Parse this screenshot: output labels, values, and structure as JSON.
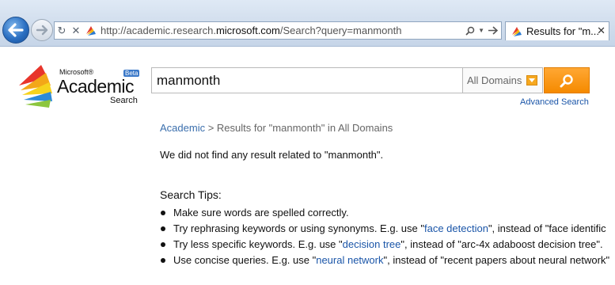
{
  "browser": {
    "url_prefix": "http://academic.research.",
    "url_domain": "microsoft.com",
    "url_suffix": "/Search?query=manmonth",
    "tab_title": "Results for \"m...",
    "icons": [
      "back-arrow-icon",
      "forward-arrow-icon",
      "refresh-icon",
      "stop-icon",
      "favicon",
      "search-icon",
      "dropdown-icon",
      "go-arrow-icon",
      "close-icon"
    ]
  },
  "logo": {
    "microsoft": "Microsoft®",
    "academic": "Academic",
    "search": "Search",
    "beta": "Beta"
  },
  "search": {
    "query": "manmonth",
    "domain": "All Domains",
    "advanced": "Advanced Search"
  },
  "breadcrumb": {
    "root": "Academic",
    "separator": ">",
    "current": "Results for \"manmonth\" in All Domains"
  },
  "message": "We did not find any result related to \"manmonth\".",
  "tips": {
    "heading": "Search Tips:",
    "items": [
      {
        "text": "Make sure words are spelled correctly."
      },
      {
        "before": "Try rephrasing keywords or using synonyms. E.g. use \"",
        "link": "face detection",
        "after": "\", instead of \"face identific"
      },
      {
        "before": "Try less specific keywords. E.g. use \"",
        "link": "decision tree",
        "after": "\", instead of \"arc-4x adaboost decision tree\"."
      },
      {
        "before": "Use concise queries. E.g. use \"",
        "link": "neural network",
        "after": "\", instead of \"recent papers about neural network\""
      }
    ]
  },
  "colors": {
    "accent": "#f58a00",
    "link": "#1a55a8",
    "chrome": "#cfdcec"
  }
}
